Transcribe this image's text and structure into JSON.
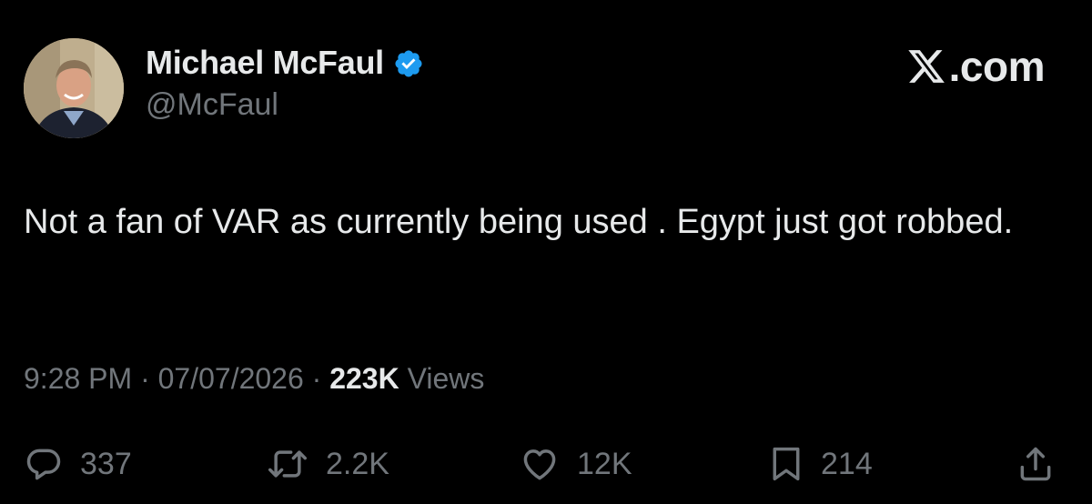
{
  "author": {
    "display_name": "Michael McFaul",
    "handle": "@McFaul",
    "verified_icon": "verified-badge-icon",
    "avatar_icon": "profile-photo"
  },
  "brand": {
    "label": ".com",
    "icon": "x-logo-icon"
  },
  "tweet": {
    "text": "Not a fan of VAR as currently being used . Egypt just got robbed."
  },
  "meta": {
    "time": "9:28 PM",
    "separator": "·",
    "date": "07/07/2026",
    "views_count": "223K",
    "views_label": "Views"
  },
  "actions": {
    "reply": {
      "icon": "reply-icon",
      "count": "337"
    },
    "repost": {
      "icon": "repost-icon",
      "count": "2.2K"
    },
    "like": {
      "icon": "heart-icon",
      "count": "12K"
    },
    "bookmark": {
      "icon": "bookmark-icon",
      "count": "214"
    },
    "share": {
      "icon": "share-icon"
    }
  },
  "colors": {
    "background": "#000000",
    "text_primary": "#e7e9ea",
    "text_secondary": "#71767b",
    "verified_blue": "#1d9bf0"
  }
}
